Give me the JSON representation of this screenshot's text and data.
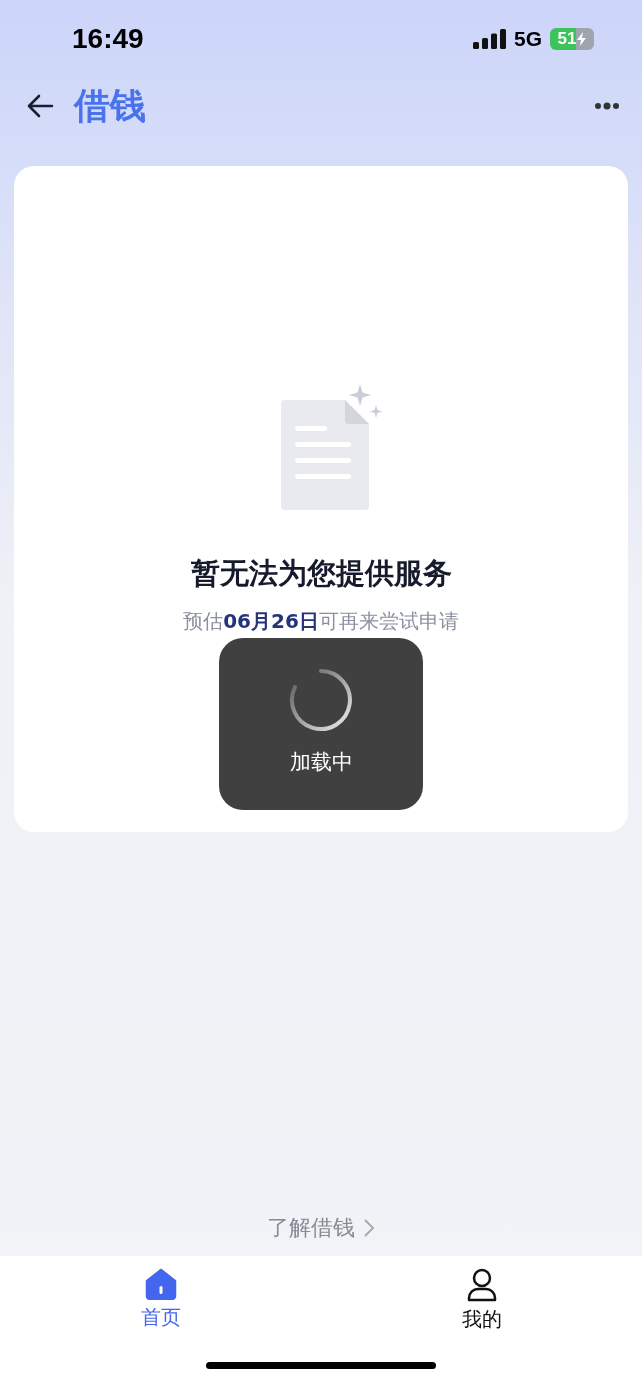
{
  "status_bar": {
    "time": "16:49",
    "network": "5G",
    "battery": "51"
  },
  "nav": {
    "title": "借钱"
  },
  "empty_state": {
    "title": "暂无法为您提供服务",
    "subtitle": "预估**06月26日**可再来尝试申请"
  },
  "loading": {
    "label": "加载中"
  },
  "link": {
    "label": "了解借钱"
  },
  "tabs": [
    {
      "label": "首页",
      "kind": "home",
      "selected": true
    },
    {
      "label": "我的",
      "kind": "profile",
      "selected": false
    }
  ]
}
